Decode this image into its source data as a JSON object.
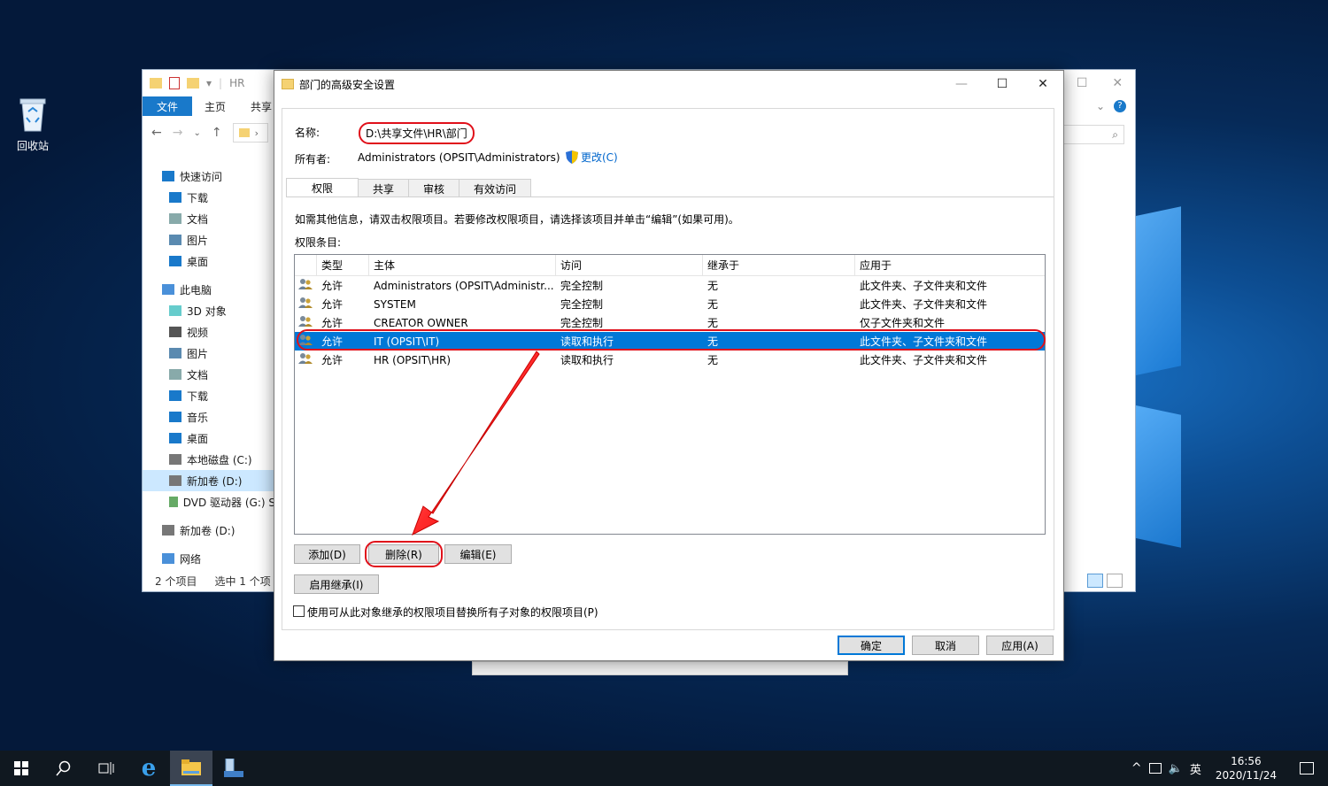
{
  "desktop": {
    "recycle_bin_label": "回收站"
  },
  "explorer": {
    "title_path": "HR",
    "ribbon": {
      "file_tab": "文件",
      "home_tab": "主页",
      "share_tab": "共享"
    },
    "nav": [
      {
        "label": "快速访问",
        "icon": "star-icon",
        "indent": 0,
        "top": true
      },
      {
        "label": "下载",
        "icon": "download-icon",
        "indent": 1
      },
      {
        "label": "文档",
        "icon": "document-icon",
        "indent": 1
      },
      {
        "label": "图片",
        "icon": "picture-icon",
        "indent": 1
      },
      {
        "label": "桌面",
        "icon": "desktop-icon",
        "indent": 1
      },
      {
        "label": "此电脑",
        "icon": "computer-icon",
        "indent": 0,
        "top": true
      },
      {
        "label": "3D 对象",
        "icon": "cube-icon",
        "indent": 1
      },
      {
        "label": "视频",
        "icon": "video-icon",
        "indent": 1
      },
      {
        "label": "图片",
        "icon": "picture-icon",
        "indent": 1
      },
      {
        "label": "文档",
        "icon": "document-icon",
        "indent": 1
      },
      {
        "label": "下载",
        "icon": "download-icon",
        "indent": 1
      },
      {
        "label": "音乐",
        "icon": "music-icon",
        "indent": 1
      },
      {
        "label": "桌面",
        "icon": "desktop-icon",
        "indent": 1
      },
      {
        "label": "本地磁盘 (C:)",
        "icon": "drive-icon",
        "indent": 1
      },
      {
        "label": "新加卷 (D:)",
        "icon": "drive-icon",
        "indent": 1,
        "selected": true
      },
      {
        "label": "DVD 驱动器 (G:) S",
        "icon": "dvd-icon",
        "indent": 1
      },
      {
        "label": "新加卷 (D:)",
        "icon": "drive-icon",
        "indent": 0,
        "top": true
      },
      {
        "label": "网络",
        "icon": "network-icon",
        "indent": 0,
        "top": true
      }
    ],
    "status": {
      "items": "2 个项目",
      "selected": "选中 1 个项"
    }
  },
  "dialog": {
    "title": "部门的高级安全设置",
    "name_label": "名称:",
    "name_value": "D:\\共享文件\\HR\\部门",
    "owner_label": "所有者:",
    "owner_value": "Administrators (OPSIT\\Administrators)",
    "change_link": "更改(C)",
    "tabs": [
      "权限",
      "共享",
      "审核",
      "有效访问"
    ],
    "active_tab": 0,
    "info_text": "如需其他信息，请双击权限项目。若要修改权限项目，请选择该项目并单击“编辑”(如果可用)。",
    "entries_label": "权限条目:",
    "columns": [
      "类型",
      "主体",
      "访问",
      "继承于",
      "应用于"
    ],
    "rows": [
      {
        "type": "允许",
        "principal": "Administrators (OPSIT\\Administr...",
        "access": "完全控制",
        "inherited": "无",
        "applies": "此文件夹、子文件夹和文件"
      },
      {
        "type": "允许",
        "principal": "SYSTEM",
        "access": "完全控制",
        "inherited": "无",
        "applies": "此文件夹、子文件夹和文件"
      },
      {
        "type": "允许",
        "principal": "CREATOR OWNER",
        "access": "完全控制",
        "inherited": "无",
        "applies": "仅子文件夹和文件"
      },
      {
        "type": "允许",
        "principal": "IT (OPSIT\\IT)",
        "access": "读取和执行",
        "inherited": "无",
        "applies": "此文件夹、子文件夹和文件"
      },
      {
        "type": "允许",
        "principal": "HR (OPSIT\\HR)",
        "access": "读取和执行",
        "inherited": "无",
        "applies": "此文件夹、子文件夹和文件"
      }
    ],
    "selected_row": 3,
    "add_button": "添加(D)",
    "remove_button": "删除(R)",
    "edit_button": "编辑(E)",
    "enable_inherit_button": "启用继承(I)",
    "replace_checkbox_label": "使用可从此对象继承的权限项目替换所有子对象的权限项目(P)",
    "ok_button": "确定",
    "cancel_button": "取消",
    "apply_button": "应用(A)"
  },
  "taskbar": {
    "ime": "英",
    "time": "16:56",
    "date": "2020/11/24"
  },
  "colors": {
    "accent": "#0078d7",
    "highlight_ring": "#e0101a"
  }
}
